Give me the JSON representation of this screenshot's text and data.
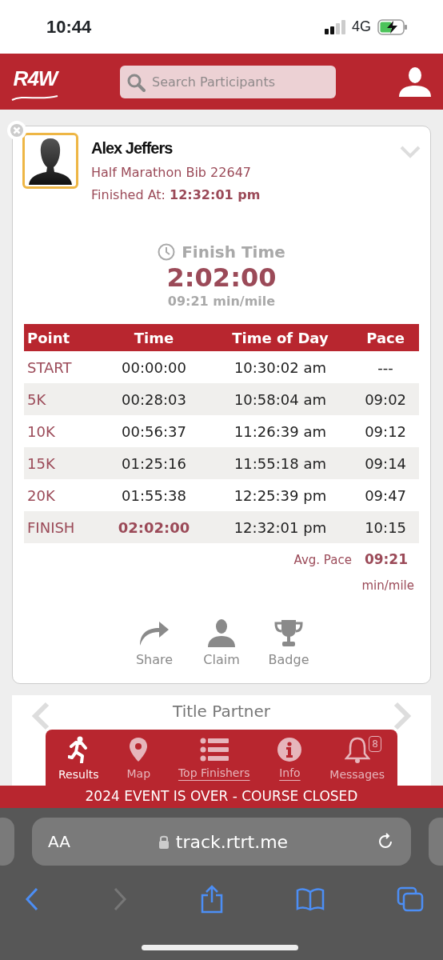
{
  "status_bar": {
    "time": "10:44",
    "network": "4G"
  },
  "header": {
    "logo": "R4W",
    "search": {
      "placeholder": "Search Participants"
    }
  },
  "participant": {
    "name": "Alex Jeffers",
    "event": "Half Marathon Bib 22647",
    "finished_label": "Finished At:",
    "finished_value": "12:32:01 pm",
    "expanded": false
  },
  "finish": {
    "label": "Finish Time",
    "time": "2:02:00",
    "pace": "09:21 min/mile"
  },
  "splits": {
    "columns": [
      "Point",
      "Time",
      "Time of Day",
      "Pace"
    ],
    "rows": [
      {
        "point": "START",
        "time": "00:00:00",
        "time_of_day": "10:30:02 am",
        "pace": "---",
        "final": false
      },
      {
        "point": "5K",
        "time": "00:28:03",
        "time_of_day": "10:58:04 am",
        "pace": "09:02",
        "final": false
      },
      {
        "point": "10K",
        "time": "00:56:37",
        "time_of_day": "11:26:39 am",
        "pace": "09:12",
        "final": false
      },
      {
        "point": "15K",
        "time": "01:25:16",
        "time_of_day": "11:55:18 am",
        "pace": "09:14",
        "final": false
      },
      {
        "point": "20K",
        "time": "01:55:38",
        "time_of_day": "12:25:39 pm",
        "pace": "09:47",
        "final": false
      },
      {
        "point": "FINISH",
        "time": "02:02:00",
        "time_of_day": "12:32:01 pm",
        "pace": "10:15",
        "final": true
      }
    ],
    "avg_label": "Avg. Pace",
    "avg_value": "09:21",
    "avg_unit": "min/mile"
  },
  "actions": [
    {
      "kind": "share",
      "label": "Share"
    },
    {
      "kind": "claim",
      "label": "Claim"
    },
    {
      "kind": "badge",
      "label": "Badge"
    }
  ],
  "partner": {
    "title": "Title Partner"
  },
  "tabs": [
    {
      "kind": "results",
      "label": "Results",
      "selected": true,
      "underlined": false
    },
    {
      "kind": "map",
      "label": "Map",
      "selected": false,
      "underlined": false
    },
    {
      "kind": "top",
      "label": "Top Finishers",
      "selected": false,
      "underlined": true
    },
    {
      "kind": "info",
      "label": "Info",
      "selected": false,
      "underlined": true
    },
    {
      "kind": "messages",
      "label": "Messages",
      "selected": false,
      "underlined": false,
      "badge": "8"
    }
  ],
  "banner": "2024 EVENT IS OVER - COURSE CLOSED",
  "browser": {
    "text_size": "AA",
    "url": "track.rtrt.me"
  }
}
